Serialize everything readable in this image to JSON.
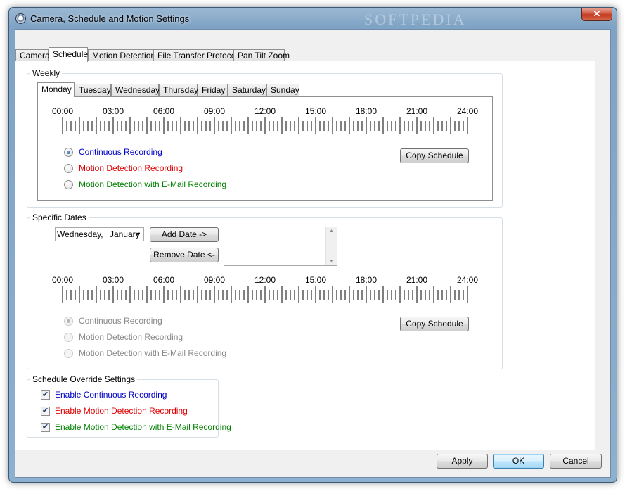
{
  "window": {
    "title": "Camera, Schedule and Motion Settings",
    "close_glyph": "✕",
    "watermark": "SOFTPEDIA"
  },
  "tabs": [
    {
      "label": "Camera"
    },
    {
      "label": "Schedule"
    },
    {
      "label": "Motion Detection"
    },
    {
      "label": "File Transfer Protocol"
    },
    {
      "label": "Pan Tilt Zoom"
    }
  ],
  "weekly": {
    "label": "Weekly",
    "days": [
      "Monday",
      "Tuesday",
      "Wednesday",
      "Thursday",
      "Friday",
      "Saturday",
      "Sunday"
    ],
    "selected_day": "Monday",
    "times": [
      "00:00",
      "03:00",
      "06:00",
      "09:00",
      "12:00",
      "15:00",
      "18:00",
      "21:00",
      "24:00"
    ],
    "options": [
      {
        "label": "Continuous Recording",
        "checked": true,
        "color": "#0000c8"
      },
      {
        "label": "Motion Detection Recording",
        "checked": false,
        "color": "#e00000"
      },
      {
        "label": "Motion Detection with E-Mail Recording",
        "checked": false,
        "color": "#008000"
      }
    ],
    "copy_button": "Copy Schedule"
  },
  "specific_dates": {
    "label": "Specific Dates",
    "date_picker": {
      "day": "Wednesday,",
      "month": "January"
    },
    "add_button": "Add Date ->",
    "remove_button": "Remove Date <-",
    "times": [
      "00:00",
      "03:00",
      "06:00",
      "09:00",
      "12:00",
      "15:00",
      "18:00",
      "21:00",
      "24:00"
    ],
    "options": [
      {
        "label": "Continuous Recording",
        "checked": true
      },
      {
        "label": "Motion Detection Recording",
        "checked": false
      },
      {
        "label": "Motion Detection with E-Mail Recording",
        "checked": false
      }
    ],
    "copy_button": "Copy Schedule"
  },
  "override": {
    "label": "Schedule Override Settings",
    "items": [
      {
        "label": "Enable Continuous Recording",
        "checked": true,
        "color": "#0000c8"
      },
      {
        "label": "Enable Motion Detection Recording",
        "checked": true,
        "color": "#e00000"
      },
      {
        "label": "Enable Motion Detection with E-Mail Recording",
        "checked": true,
        "color": "#008000"
      }
    ]
  },
  "footer": {
    "apply": "Apply",
    "ok": "OK",
    "cancel": "Cancel"
  }
}
